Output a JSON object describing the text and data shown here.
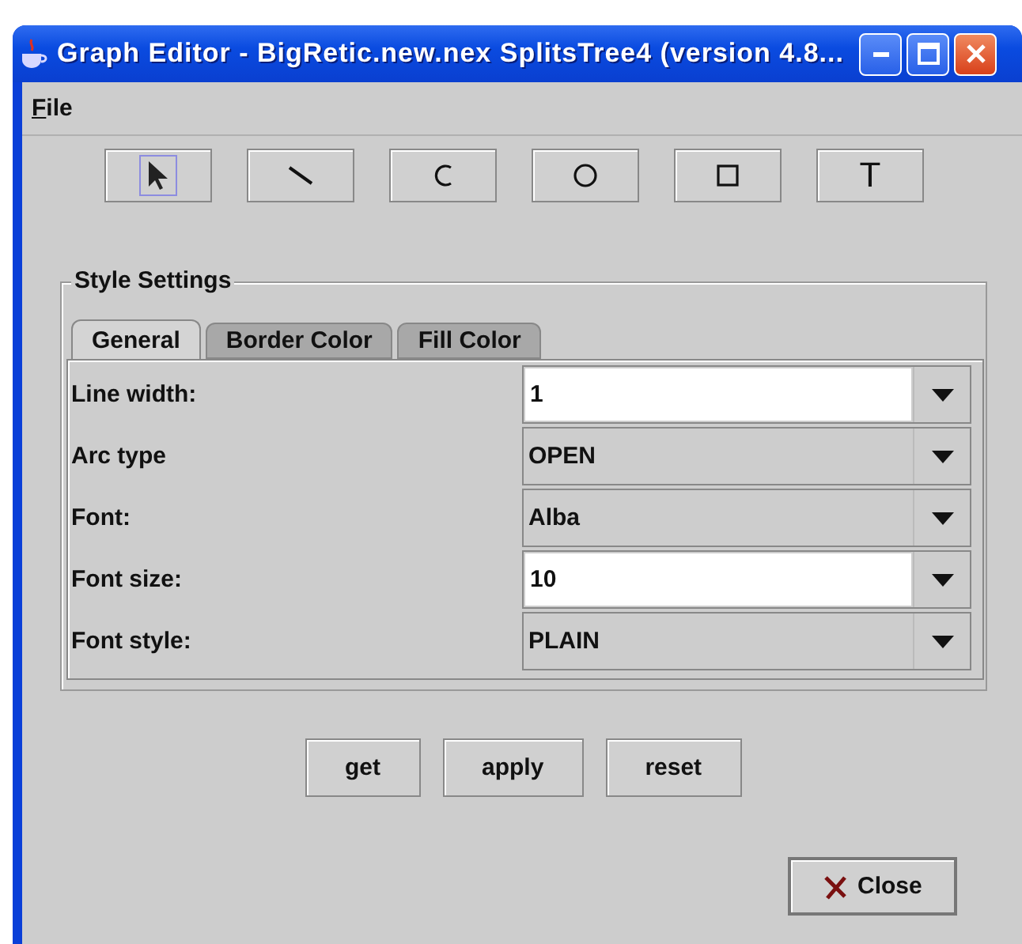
{
  "window": {
    "title": "Graph Editor - BigRetic.new.nex SplitsTree4 (version 4.8..."
  },
  "menu": [
    {
      "label": "File"
    }
  ],
  "tools": [
    {
      "kind": "select",
      "selected": true
    },
    {
      "kind": "line",
      "selected": false
    },
    {
      "kind": "arc",
      "selected": false
    },
    {
      "kind": "oval",
      "selected": false
    },
    {
      "kind": "rect",
      "selected": false
    },
    {
      "kind": "text",
      "label": "T",
      "selected": false
    }
  ],
  "style_settings": {
    "title": "Style Settings",
    "tabs": [
      {
        "label": "General",
        "selected": true
      },
      {
        "label": "Border Color",
        "selected": false
      },
      {
        "label": "Fill Color",
        "selected": false
      }
    ],
    "rows": [
      {
        "label": "Line width:",
        "value": "1",
        "kind": "editable"
      },
      {
        "label": "Arc type",
        "value": "OPEN",
        "kind": "choice"
      },
      {
        "label": "Font:",
        "value": "Alba",
        "kind": "choice"
      },
      {
        "label": "Font size:",
        "value": "10",
        "kind": "editable"
      },
      {
        "label": "Font style:",
        "value": "PLAIN",
        "kind": "choice"
      }
    ]
  },
  "buttons": [
    "get",
    "apply",
    "reset"
  ],
  "close_button": "Close"
}
